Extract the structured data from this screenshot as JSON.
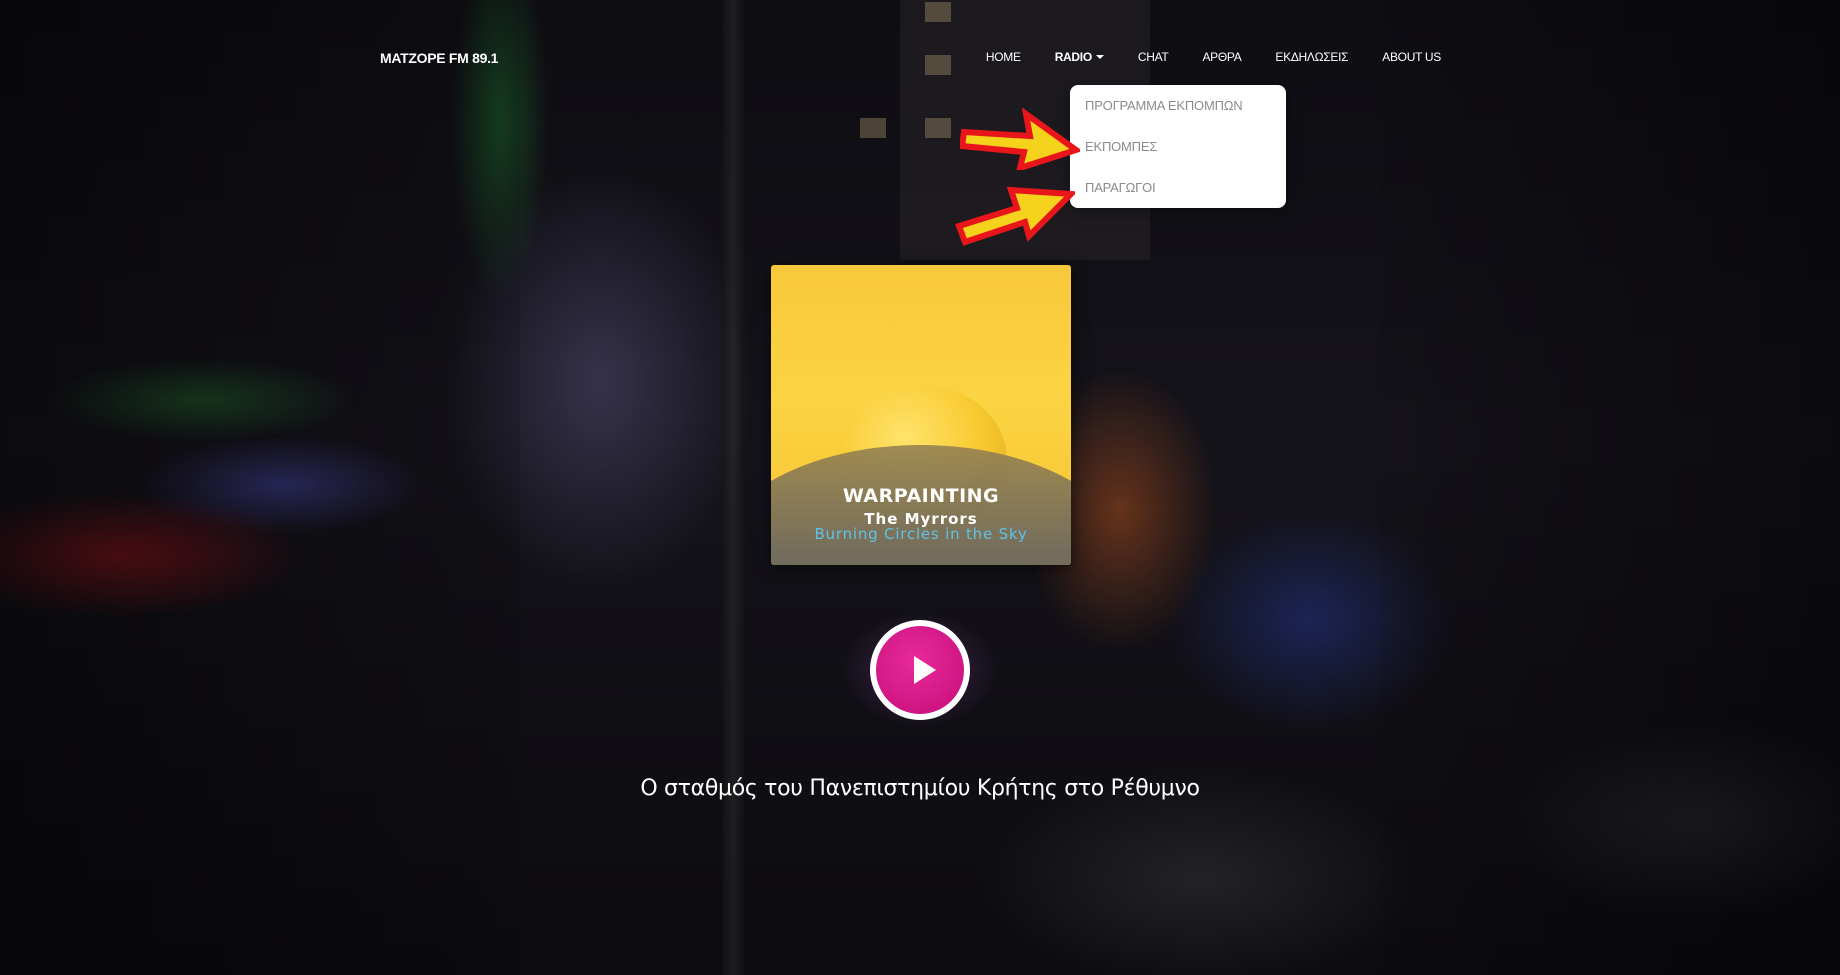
{
  "brand": "MATZOPE FM 89.1",
  "nav": {
    "items": [
      {
        "label": "HOME"
      },
      {
        "label": "RADIO"
      },
      {
        "label": "CHAT"
      },
      {
        "label": "ΑΡΘΡΑ"
      },
      {
        "label": "ΕΚΔΗΛΩΣΕΙΣ"
      },
      {
        "label": "ABOUT US"
      }
    ]
  },
  "dropdown": {
    "items": [
      {
        "label": "ΠΡΟΓΡΑΜΜΑ ΕΚΠΟΜΠΩΝ"
      },
      {
        "label": "ΕΚΠΟΜΠΕΣ"
      },
      {
        "label": "ΠΑΡΑΓΩΓΟΙ"
      }
    ]
  },
  "now_playing": {
    "album": "WARPAINTING",
    "artist": "The Myrrors",
    "track": "Burning Circles in the Sky"
  },
  "tagline": "Ο σταθμός του Πανεπιστημίου Κρήτης στο Ρέθυμνο",
  "colors": {
    "accent": "#d01583",
    "dropdown_text": "#8b8b8b",
    "track_text": "#5ec3e6",
    "arrow_fill": "#f5d31c",
    "arrow_stroke": "#e8161b"
  },
  "icons": {
    "play": "play-icon",
    "caret": "caret-down-icon",
    "annotation": "arrow-icon"
  }
}
